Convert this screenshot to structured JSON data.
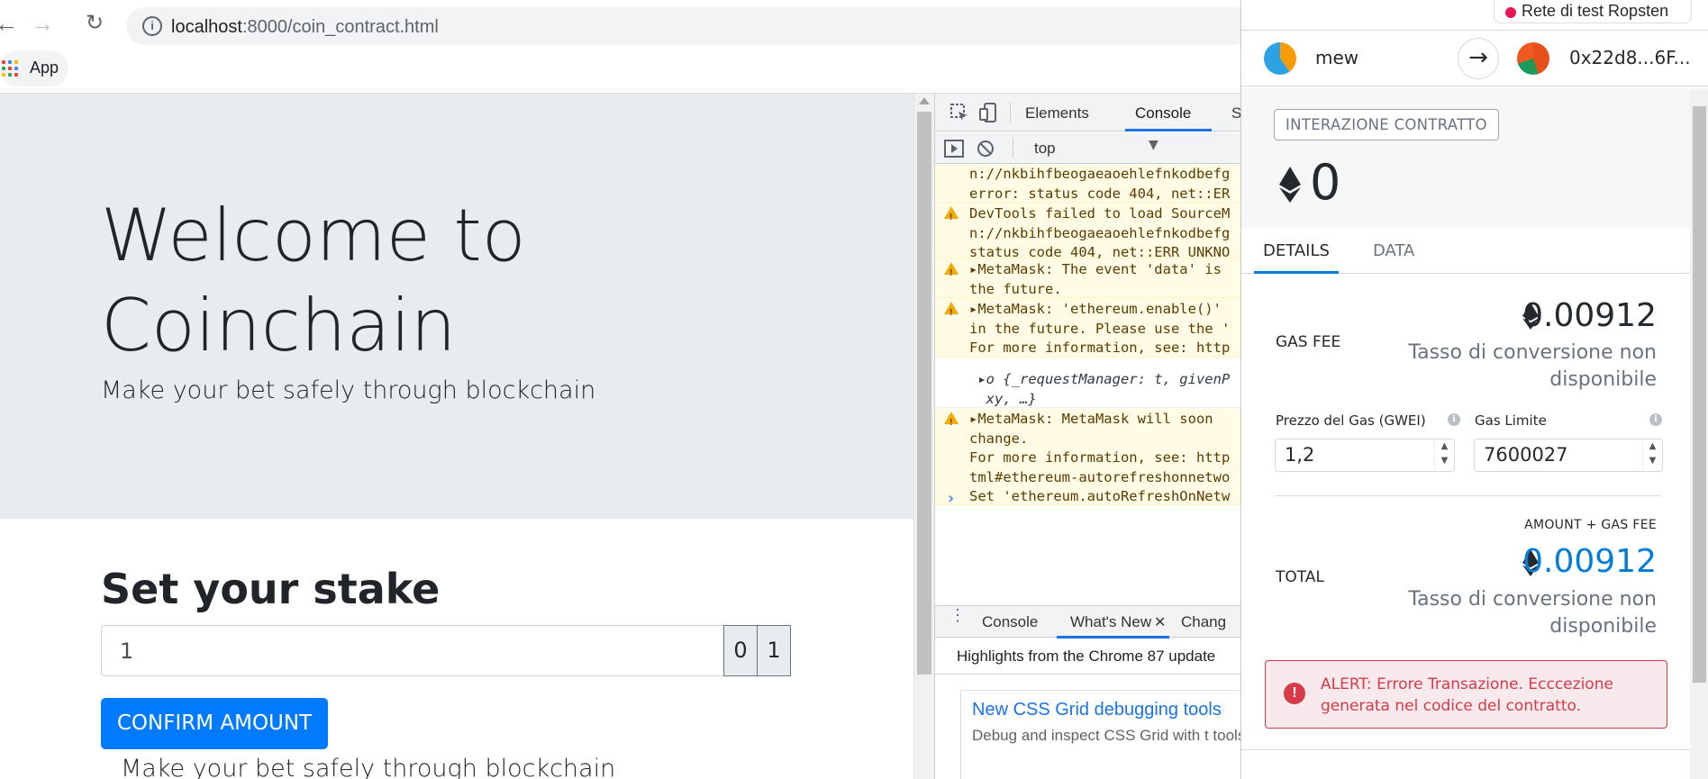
{
  "browser": {
    "url_host": "localhost",
    "url_path": ":8000/coin_contract.html",
    "bookmark_apps_label": "App"
  },
  "page": {
    "title": "Welcome to Coinchain",
    "lead": "Make your bet safely through blockchain",
    "stake_heading": "Set your stake",
    "stake_value": "1",
    "stake_option_0": "0",
    "stake_option_1": "1",
    "confirm_label": "CONFIRM AMOUNT",
    "footer_lead": "Make your bet safely through blockchain"
  },
  "devtools": {
    "tabs": [
      "Elements",
      "Console",
      "Sc"
    ],
    "context": "top",
    "messages": [
      {
        "text": "n://nkbihfbeogaeaoehlefnkodbefg\nerror: status code 404, net::ER"
      },
      {
        "text": "DevTools failed to load SourceM\nn://nkbihfbeogaeaoehlefnkodbefg\nstatus code 404, net::ERR_UNKNO"
      },
      {
        "text": "▸MetaMask: The event 'data' is\nthe future."
      },
      {
        "text": "▸MetaMask: 'ethereum.enable()'\nin the future. Please use the '\nFor more information, see: http"
      },
      {
        "text": " ▸o {_requestManager: t, givenP\n  xy, …}"
      },
      {
        "text": "▸MetaMask: MetaMask will soon\nchange.\nFor more information, see: http\ntml#ethereum-autorefreshonnetwo\nSet 'ethereum.autoRefreshOnNetw"
      }
    ],
    "drawer_tabs": [
      "Console",
      "What's New",
      "Chang"
    ],
    "highlights": "Highlights from the Chrome 87 update",
    "news_title": "New CSS Grid debugging tools",
    "news_desc": "Debug and inspect CSS Grid with t tools."
  },
  "metamask": {
    "network": "Rete di test Ropsten",
    "from_account": "mew",
    "to_account": "0x22d8...6F...",
    "action": "INTERAZIONE CONTRATTO",
    "amount": "0",
    "tab_details": "DETAILS",
    "tab_data": "DATA",
    "gas_fee_label": "GAS FEE",
    "gas_fee_value": "0.00912",
    "conversion_unavailable": "Tasso di conversione non disponibile",
    "gas_price_label": "Prezzo del Gas (GWEI)",
    "gas_price_value": "1,2",
    "gas_limit_label": "Gas Limite",
    "gas_limit_value": "7600027",
    "amount_gas_label": "AMOUNT + GAS FEE",
    "total_label": "TOTAL",
    "total_value": "0.00912",
    "alert": "ALERT: Errore Transazione. Ecccezione generata nel codice del contratto.",
    "colors": {
      "accent": "#037dd6",
      "error": "#d73a49",
      "network_dot": "#e91550"
    }
  }
}
